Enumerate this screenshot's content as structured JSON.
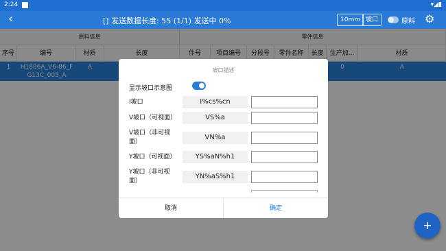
{
  "status_bar": {
    "time": "2:24",
    "icons": "▾◢▮"
  },
  "app_bar": {
    "back_icon": "‹",
    "title": "[] 发送数据长度: 55 (1/1) 发送中 0%",
    "chip_mm": "10mm",
    "chip_bevel": "坡口",
    "raw_label": "原料",
    "gear_icon": "⚙"
  },
  "table": {
    "group_left": "原料信息",
    "group_right": "零件信息",
    "columns": [
      "序号",
      "编号",
      "材质",
      "长度",
      "件号",
      "项目编号",
      "分段号",
      "零件名称",
      "长度",
      "生产加...",
      "材质"
    ],
    "row": {
      "index": "1",
      "code": "H1886A_V6-86_FG13C_005_A",
      "material": "A",
      "production": "0",
      "part_material": "A"
    }
  },
  "dialog": {
    "title": "坡口描述",
    "show_label": "显示坡口示意图",
    "rows": [
      {
        "label": "I坡口",
        "code": "I%cs%cn"
      },
      {
        "label": "V坡口（可视面）",
        "code": "VS%a"
      },
      {
        "label": "V坡口（非可视面）",
        "code": "VN%a"
      },
      {
        "label": "Y坡口（可视面）",
        "code": "YS%aN%h1"
      },
      {
        "label": "Y坡口（非可视面）",
        "code": "YN%aS%h1"
      }
    ],
    "cancel": "取消",
    "ok": "确定"
  },
  "fab_icon": "+"
}
